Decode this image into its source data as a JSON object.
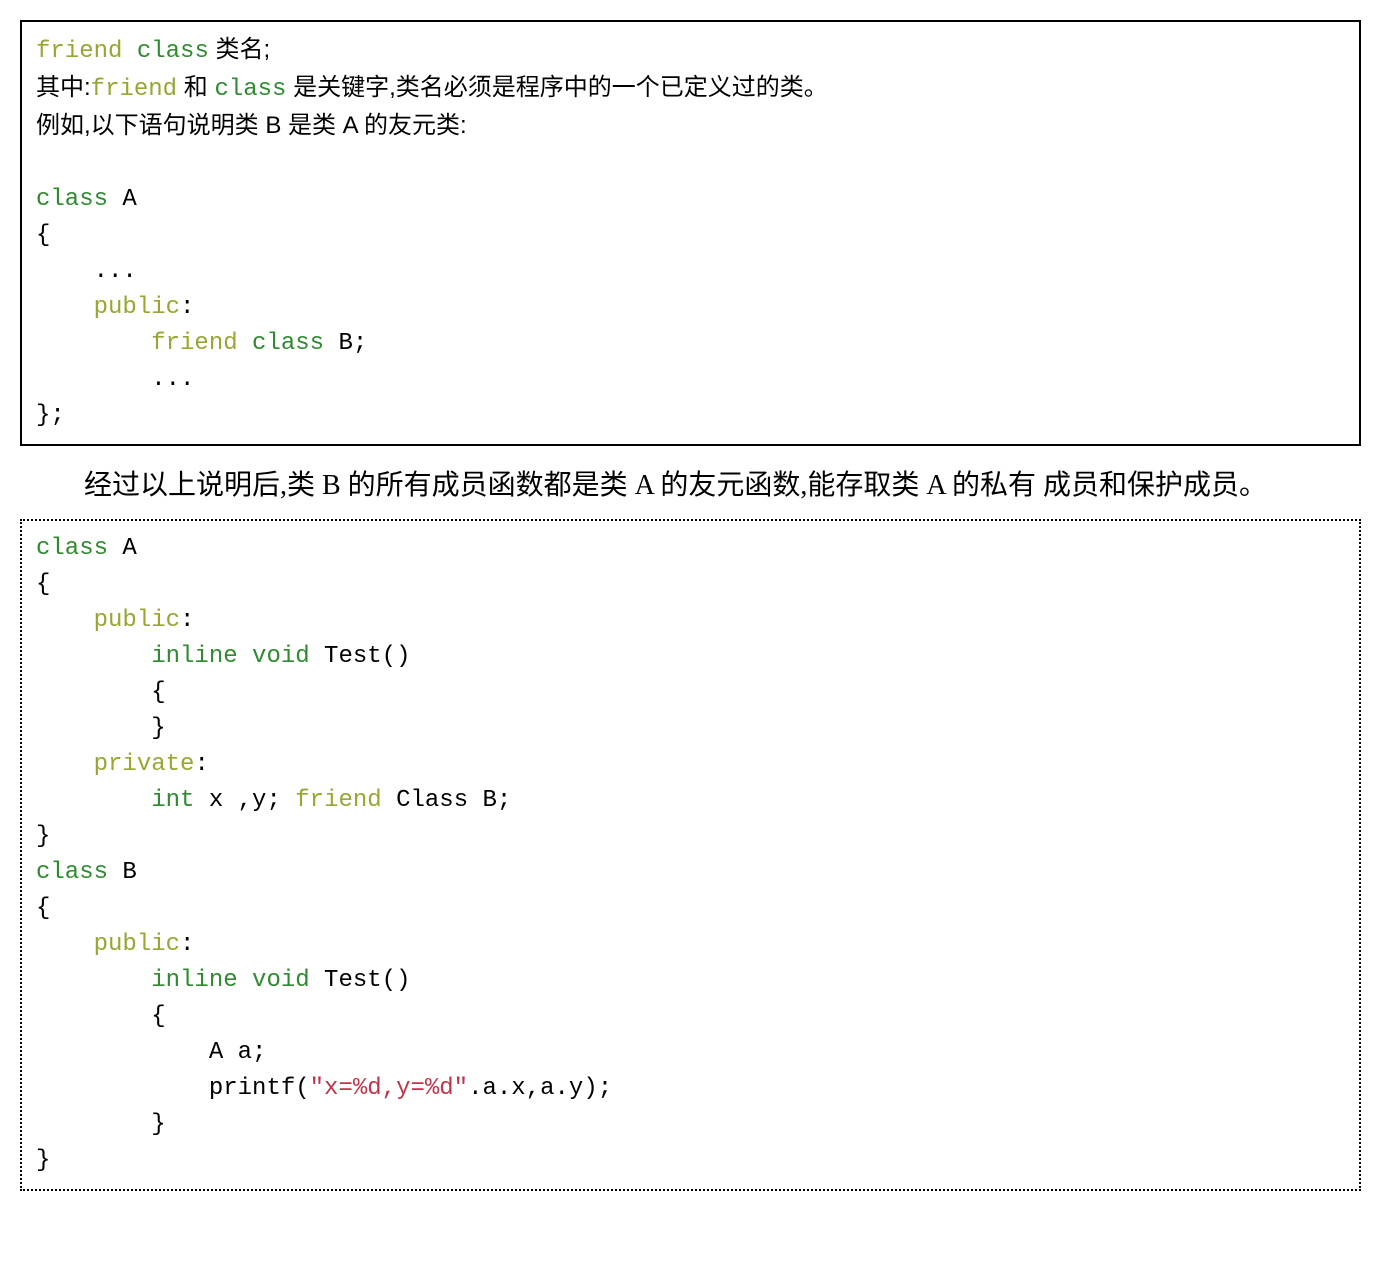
{
  "box1": {
    "l1_friend": "friend",
    "l1_class": "class",
    "l1_rest": " 类名;",
    "l2_pre": "其中:",
    "l2_friend": "friend",
    "l2_mid": " 和 ",
    "l2_class": "class",
    "l2_rest": " 是关键字,类名必须是程序中的一个已定义过的类。",
    "l3": "例如,以下语句说明类 B 是类 A 的友元类:",
    "blank": "",
    "l5_class": "class",
    "l5_rest": " A",
    "l6": "{",
    "l7": "    ...",
    "l8_public": "    public",
    "l8_colon": ":",
    "l9_pad": "        ",
    "l9_friend": "friend",
    "l9_sp": " ",
    "l9_class": "class",
    "l9_rest": " B;",
    "l10": "        ...",
    "l11": "};"
  },
  "prose": {
    "text": "经过以上说明后,类 B 的所有成员函数都是类 A 的友元函数,能存取类 A 的私有 成员和保护成员。"
  },
  "box2": {
    "l1_class": "class",
    "l1_rest": " A",
    "l2": "{",
    "l3_pad": "    ",
    "l3_public": "public",
    "l3_colon": ":",
    "l4_pad": "        ",
    "l4_inline": "inline",
    "l4_sp": " ",
    "l4_void": "void",
    "l4_rest": " Test()",
    "l5": "        {",
    "l6": "        }",
    "l7_pad": "    ",
    "l7_private": "private",
    "l7_colon": ":",
    "l8_pad": "        ",
    "l8_int": "int",
    "l8_mid": " x ,y; ",
    "l8_friend": "friend",
    "l8_rest": " Class B;",
    "l9": "}",
    "l10_class": "class",
    "l10_rest": " B",
    "l11": "{",
    "l12_pad": "    ",
    "l12_public": "public",
    "l12_colon": ":",
    "l13_pad": "        ",
    "l13_inline": "inline",
    "l13_sp": " ",
    "l13_void": "void",
    "l13_rest": " Test()",
    "l14": "        {",
    "l15": "            A a;",
    "l16_pad": "            printf(",
    "l16_str": "\"x=%d,y=%d\"",
    "l16_rest": ".a.x,a.y);",
    "l17": "        }",
    "l18": "}"
  }
}
